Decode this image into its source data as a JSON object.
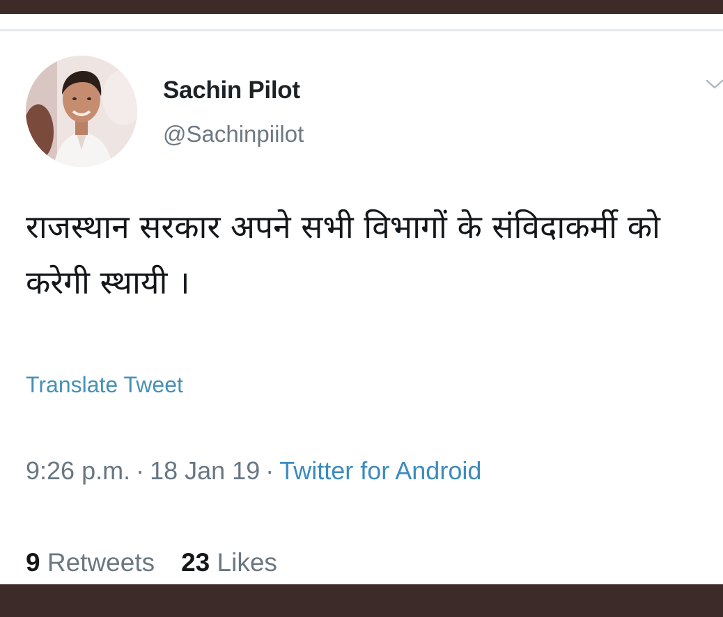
{
  "tweet": {
    "author_name": "Sachin Pilot",
    "author_handle": "@Sachinpiilot",
    "text": "राजस्थान सरकार अपने सभी विभागों के संविदाकर्मी को करेगी स्थायी ।",
    "translate_label": "Translate Tweet",
    "time": "9:26 p.m.",
    "separator": "·",
    "date": "18 Jan 19",
    "source": "Twitter for Android",
    "retweets_count": "9",
    "retweets_label": "Retweets",
    "likes_count": "23",
    "likes_label": "Likes",
    "menu_icon": "chevron-down-icon",
    "avatar_icon": "profile-photo"
  },
  "colors": {
    "frame": "#3d2b2a",
    "link": "#3b8bbf",
    "translate_link": "#4591b4",
    "secondary_text": "#687782",
    "primary_text": "#14171a"
  }
}
